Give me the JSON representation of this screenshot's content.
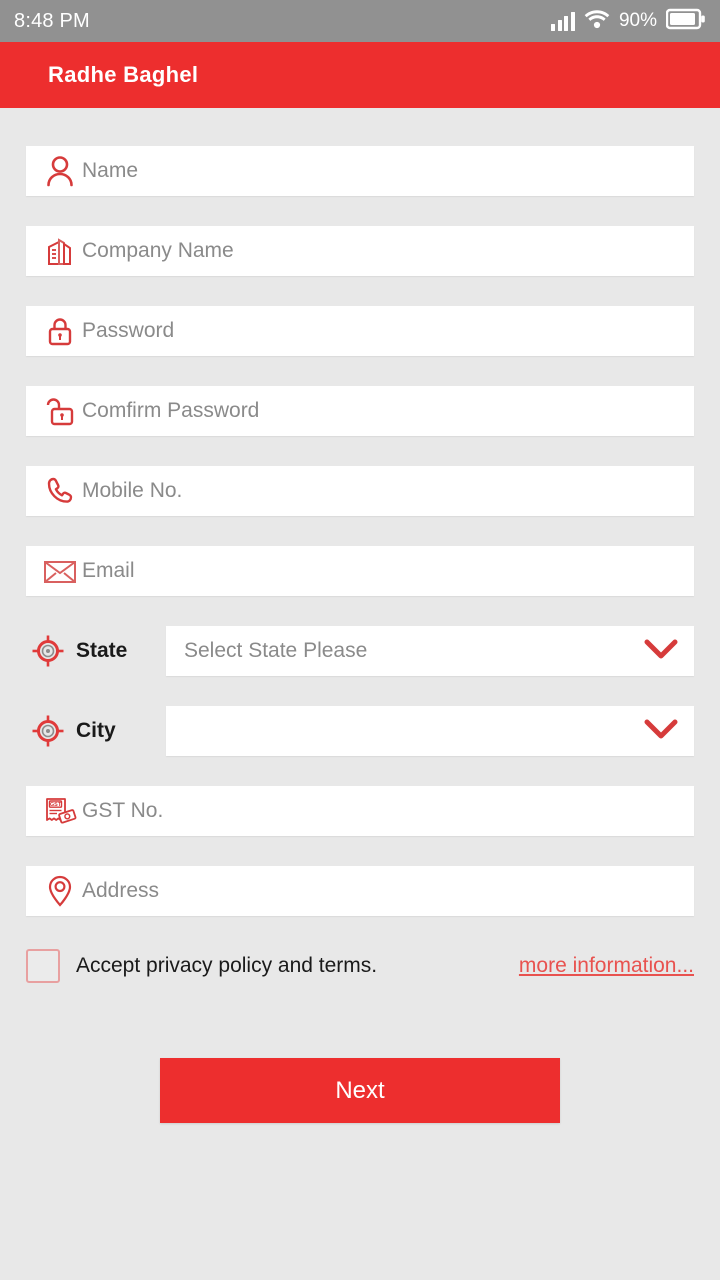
{
  "status_bar": {
    "time": "8:48 PM",
    "battery_percent": "90%",
    "signal_icon": "signal-bars-icon",
    "wifi_icon": "wifi-icon",
    "battery_icon": "battery-icon",
    "background_color": "#919191"
  },
  "app_bar": {
    "title": "Radhe Baghel",
    "background_color": "#ed2e2e",
    "title_color": "#ffffff"
  },
  "theme": {
    "accent": "#ed2e2e",
    "page_background": "#e8e8e8",
    "field_background": "#ffffff",
    "placeholder_color": "#8a8a8a",
    "link_color": "#e8524f"
  },
  "form": {
    "fields": [
      {
        "id": "name",
        "placeholder": "Name",
        "icon": "person-icon",
        "value": ""
      },
      {
        "id": "company-name",
        "placeholder": "Company Name",
        "icon": "building-icon",
        "value": ""
      },
      {
        "id": "password",
        "placeholder": "Password",
        "icon": "lock-closed-icon",
        "value": ""
      },
      {
        "id": "confirm-password",
        "placeholder": "Comfirm Password",
        "icon": "lock-open-icon",
        "value": ""
      },
      {
        "id": "mobile-no",
        "placeholder": "Mobile No.",
        "icon": "phone-icon",
        "value": ""
      },
      {
        "id": "email",
        "placeholder": "Email",
        "icon": "envelope-icon",
        "value": ""
      }
    ],
    "selects": [
      {
        "id": "state",
        "label": "State",
        "icon": "crosshair-icon",
        "value": "Select State Please",
        "chevron": "chevron-down-icon"
      },
      {
        "id": "city",
        "label": "City",
        "icon": "crosshair-icon",
        "value": "",
        "chevron": "chevron-down-icon"
      }
    ],
    "fields_after": [
      {
        "id": "gst-no",
        "placeholder": "GST No.",
        "icon": "gst-receipt-icon",
        "value": ""
      },
      {
        "id": "address",
        "placeholder": "Address",
        "icon": "map-pin-icon",
        "value": ""
      }
    ],
    "terms": {
      "checkbox_checked": false,
      "label": "Accept privacy policy and terms.",
      "link_label": "more information..."
    },
    "submit": {
      "label": "Next"
    }
  }
}
